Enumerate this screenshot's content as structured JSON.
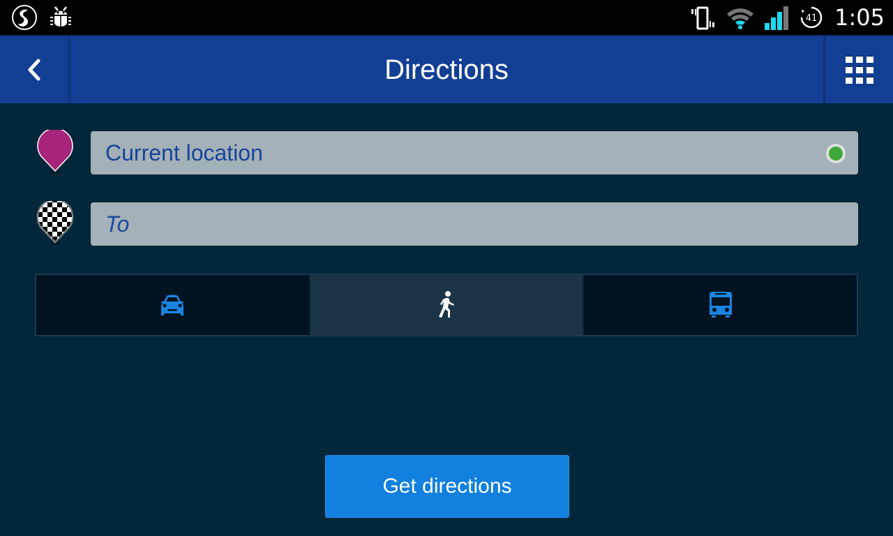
{
  "status_bar": {
    "left_icons": [
      "swiftkey-icon",
      "debug-bug-icon"
    ],
    "right_icons": [
      "vibrate-icon",
      "wifi-icon",
      "cell-signal-icon",
      "sync-badge-icon"
    ],
    "badge_number": "41",
    "time": "1:05"
  },
  "app_bar": {
    "title": "Directions",
    "back_icon": "chevron-left-icon",
    "menu_icon": "grid-menu-icon"
  },
  "from_field": {
    "value": "Current location",
    "pin_color": "#a6247a",
    "status_color": "#3fa83a"
  },
  "to_field": {
    "placeholder": "To"
  },
  "modes": [
    {
      "name": "car",
      "icon": "car-icon",
      "active": false,
      "color": "#1a84e0"
    },
    {
      "name": "walk",
      "icon": "walk-icon",
      "active": true,
      "color": "#ffffff"
    },
    {
      "name": "transit",
      "icon": "bus-icon",
      "active": false,
      "color": "#1a84e0"
    }
  ],
  "actions": {
    "get_directions_label": "Get directions"
  },
  "colors": {
    "app_bar": "#123f94",
    "background": "#02263a",
    "field": "#a5b1b8",
    "primary_button": "#1180de"
  }
}
